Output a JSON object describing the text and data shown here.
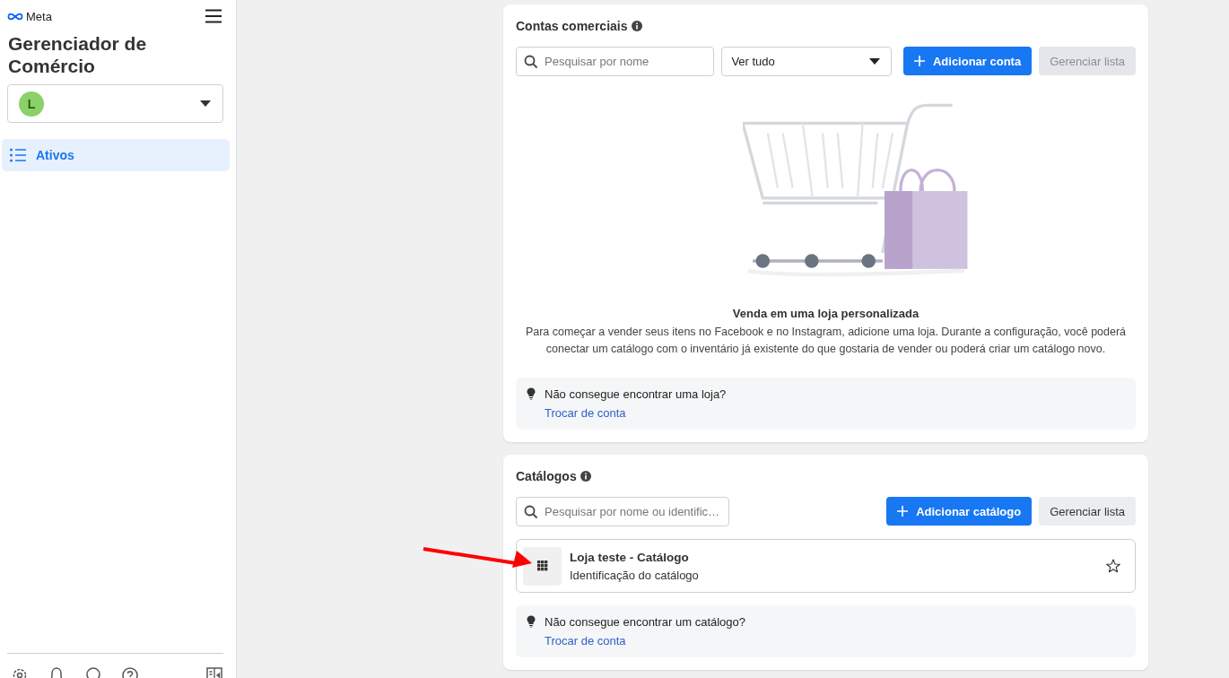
{
  "app": {
    "brand": "Meta",
    "title": "Gerenciador de Comércio"
  },
  "account_selector": {
    "avatar_letter": "L"
  },
  "nav": [
    {
      "label": "Ativos",
      "selected": true
    }
  ],
  "business_accounts": {
    "title": "Contas comerciais",
    "search": {
      "placeholder": "Pesquisar por nome"
    },
    "filter": {
      "value": "Ver tudo"
    },
    "buttons": [
      {
        "label": "Adicionar conta",
        "kind": "primary",
        "disabled": false
      },
      {
        "label": "Gerenciar lista",
        "kind": "secondary",
        "disabled": true
      }
    ],
    "empty_state": {
      "title": "Venda em uma loja personalizada",
      "description": "Para começar a vender seus itens no Facebook e no Instagram, adicione uma loja. Durante a configuração, você poderá conectar um catálogo com o inventário já existente do que gostaria de vender ou poderá criar um catálogo novo."
    },
    "hint": {
      "text": "Não consegue encontrar uma loja?",
      "link": "Trocar de conta"
    }
  },
  "catalogs": {
    "title": "Catálogos",
    "search": {
      "placeholder": "Pesquisar por nome ou identific…"
    },
    "buttons": [
      {
        "label": "Adicionar catálogo",
        "kind": "primary",
        "disabled": false
      },
      {
        "label": "Gerenciar lista",
        "kind": "secondary",
        "disabled": false
      }
    ],
    "items": [
      {
        "name": "Loja teste - Catálogo",
        "subtitle": "Identificação do catálogo",
        "favorite": false
      }
    ],
    "hint": {
      "text": "Não consegue encontrar um catálogo?",
      "link": "Trocar de conta"
    }
  }
}
